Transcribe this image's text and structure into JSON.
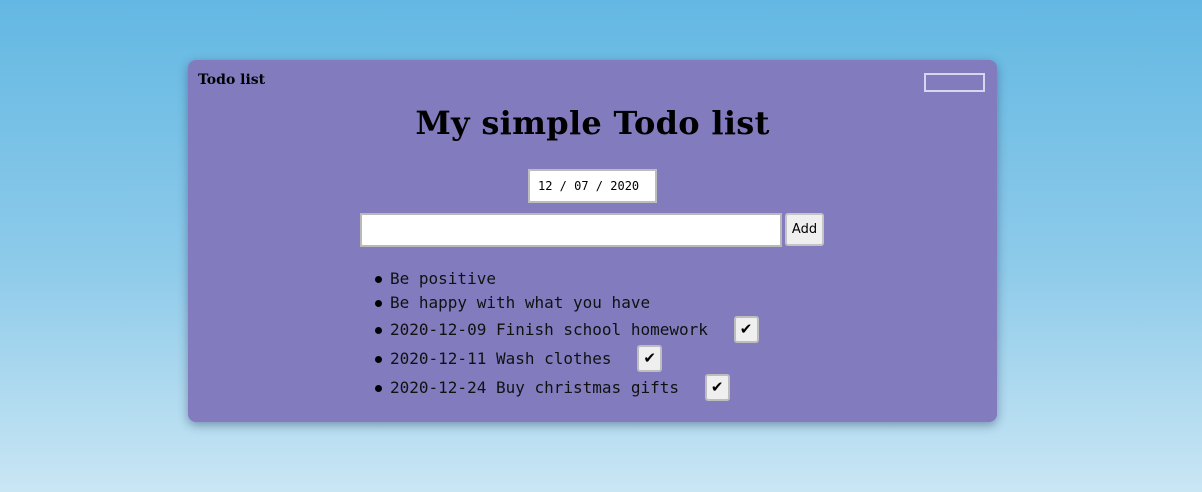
{
  "app": {
    "title": "Todo list"
  },
  "heading": "My simple Todo list",
  "date_input": {
    "value": "12 / 07 / 2020"
  },
  "todo_input": {
    "value": "",
    "placeholder": ""
  },
  "add_button": {
    "label": "Add"
  },
  "todos": [
    {
      "text": "Be positive"
    },
    {
      "text": "Be happy with what you have"
    },
    {
      "text": "2020-12-09 Finish school homework",
      "check_icon": "checkmark-icon"
    },
    {
      "text": "2020-12-11 Wash clothes",
      "check_icon": "checkmark-icon"
    },
    {
      "text": "2020-12-24 Buy christmas gifts",
      "check_icon": "checkmark-icon"
    }
  ],
  "check_glyph": "✔",
  "colors": {
    "card_background": "#827cbf",
    "page_gradient_top": "#63b8e3",
    "page_gradient_bottom": "#c9e6f4"
  }
}
